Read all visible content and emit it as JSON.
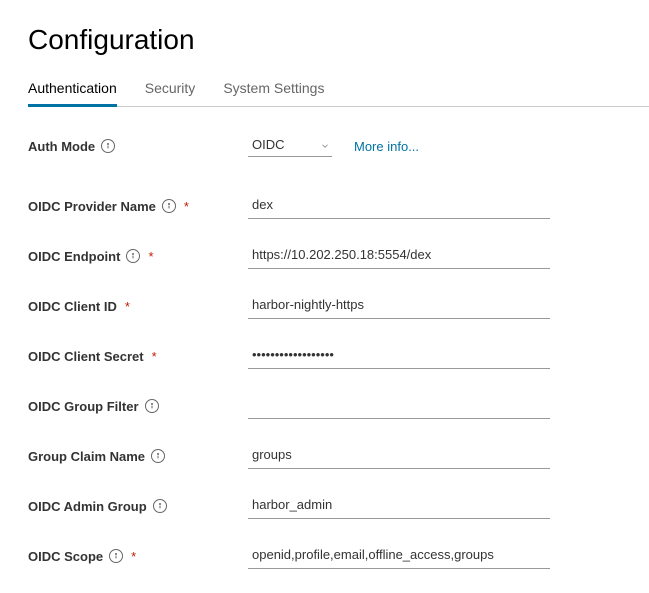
{
  "title": "Configuration",
  "tabs": [
    {
      "label": "Authentication",
      "active": true
    },
    {
      "label": "Security",
      "active": false
    },
    {
      "label": "System Settings",
      "active": false
    }
  ],
  "authMode": {
    "label": "Auth Mode",
    "value": "OIDC",
    "moreInfo": "More info..."
  },
  "fields": {
    "providerName": {
      "label": "OIDC Provider Name",
      "value": "dex",
      "required": true,
      "info": true
    },
    "endpoint": {
      "label": "OIDC Endpoint",
      "value": "https://10.202.250.18:5554/dex",
      "required": true,
      "info": true
    },
    "clientId": {
      "label": "OIDC Client ID",
      "value": "harbor-nightly-https",
      "required": true,
      "info": false
    },
    "clientSecret": {
      "label": "OIDC Client Secret",
      "value": "••••••••••••••••••",
      "required": true,
      "info": false
    },
    "groupFilter": {
      "label": "OIDC Group Filter",
      "value": "",
      "required": false,
      "info": true
    },
    "groupClaim": {
      "label": "Group Claim Name",
      "value": "groups",
      "required": false,
      "info": true
    },
    "adminGroup": {
      "label": "OIDC Admin Group",
      "value": "harbor_admin",
      "required": false,
      "info": true
    },
    "scope": {
      "label": "OIDC Scope",
      "value": "openid,profile,email,offline_access,groups",
      "required": true,
      "info": true
    }
  }
}
